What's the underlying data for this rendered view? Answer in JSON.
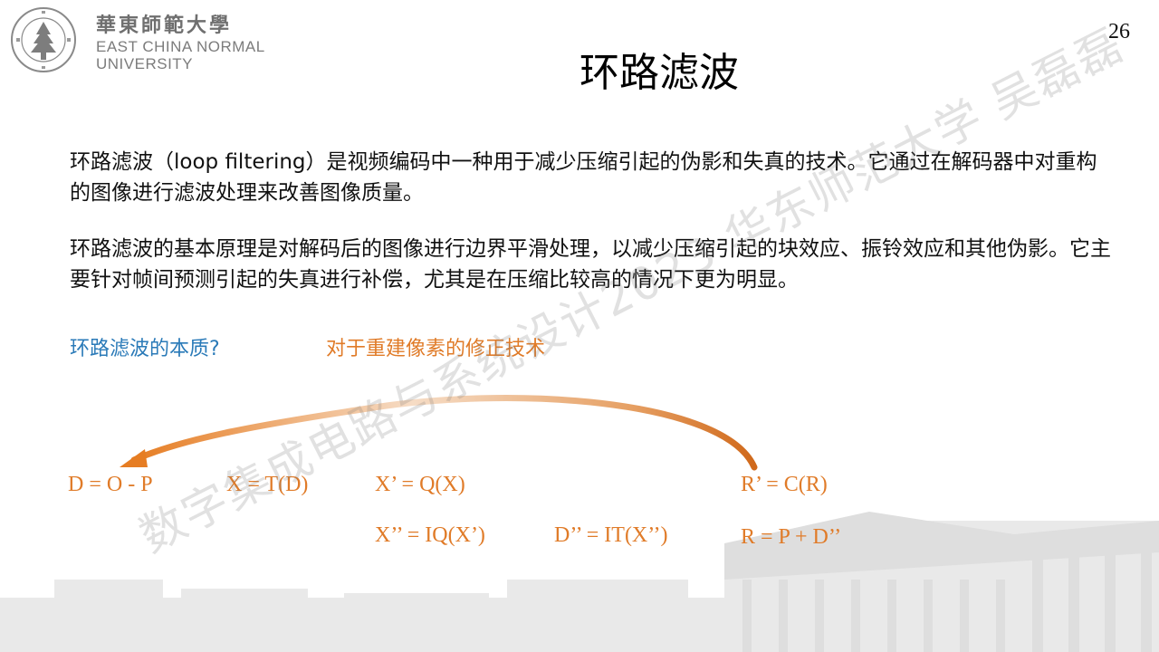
{
  "header": {
    "logo_cn": "華東師範大學",
    "logo_en_line1": "EAST CHINA NORMAL",
    "logo_en_line2": "UNIVERSITY",
    "page_number": "26"
  },
  "slide": {
    "title": "环路滤波",
    "paragraph1": "环路滤波（loop filtering）是视频编码中一种用于减少压缩引起的伪影和失真的技术。它通过在解码器中对重构的图像进行滤波处理来改善图像质量。",
    "paragraph2": "环路滤波的基本原理是对解码后的图像进行边界平滑处理，以减少压缩引起的块效应、振铃效应和其他伪影。它主要针对帧间预测引起的失真进行补偿，尤其是在压缩比较高的情况下更为明显。",
    "question": "环路滤波的本质?",
    "answer": "对于重建像素的修正技术"
  },
  "formulas": {
    "d": "D = O - P",
    "x": "X = T(D)",
    "xq": "X’ = Q(X)",
    "rc": "R’ = C(R)",
    "xiq": "X’’ = IQ(X’)",
    "dit": "D’’ = IT(X’’)",
    "r": "R = P + D’’"
  },
  "watermark": "数字集成电路与系统设计2023 华东师范大学 吴磊磊",
  "colors": {
    "accent_orange": "#e07b28",
    "question_blue": "#2a7ab8"
  }
}
